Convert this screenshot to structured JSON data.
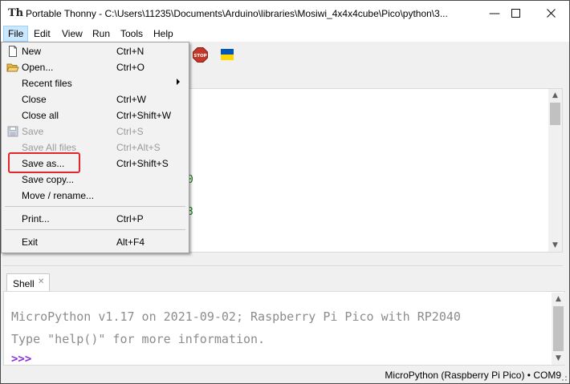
{
  "window": {
    "title": "Portable Thonny  -  C:\\Users\\11235\\Documents\\Arduino\\libraries\\Mosiwi_4x4x4cube\\Pico\\python\\3...",
    "app_icon_glyph": "Th",
    "controls": {
      "minimize": "—",
      "maximize": "☐",
      "close": "✕"
    }
  },
  "menubar": {
    "items": [
      {
        "label": "File"
      },
      {
        "label": "Edit"
      },
      {
        "label": "View"
      },
      {
        "label": "Run"
      },
      {
        "label": "Tools"
      },
      {
        "label": "Help"
      }
    ]
  },
  "toolbar": {
    "icons": [
      "stop-icon",
      "ukraine-flag-icon"
    ],
    "stop_text": "STOP"
  },
  "file_menu": {
    "items": [
      {
        "label": "New",
        "accel": "Ctrl+N",
        "icon": "new-file-icon",
        "enabled": true
      },
      {
        "label": "Open...",
        "accel": "Ctrl+O",
        "icon": "open-folder-icon",
        "enabled": true
      },
      {
        "label": "Recent files",
        "accel": "",
        "submenu": true,
        "enabled": true
      },
      {
        "label": "Close",
        "accel": "Ctrl+W",
        "enabled": true
      },
      {
        "label": "Close all",
        "accel": "Ctrl+Shift+W",
        "enabled": true
      },
      {
        "label": "Save",
        "accel": "Ctrl+S",
        "icon": "save-icon",
        "enabled": false
      },
      {
        "label": "Save All files",
        "accel": "Ctrl+Alt+S",
        "enabled": false
      },
      {
        "label": "Save as...",
        "accel": "Ctrl+Shift+S",
        "enabled": true,
        "highlighted": true
      },
      {
        "label": "Save copy...",
        "accel": "",
        "enabled": true
      },
      {
        "label": "Move / rename...",
        "accel": "",
        "enabled": true
      },
      {
        "label": "Print...",
        "accel": "Ctrl+P",
        "enabled": true
      },
      {
        "label": "Exit",
        "accel": "Alt+F4",
        "enabled": true
      }
    ],
    "highlight_color": "#e3262b"
  },
  "editor": {
    "visible_fragments": [
      "0",
      "3"
    ]
  },
  "shell": {
    "tab_label": "Shell",
    "tab_close": "✕",
    "lines": [
      "MicroPython v1.17 on 2021-09-02; Raspberry Pi Pico with RP2040",
      "Type \"help()\" for more information."
    ],
    "prompt": ">>>"
  },
  "statusbar": {
    "text": "MicroPython (Raspberry Pi Pico)  •  COM9"
  },
  "colors": {
    "menu_active_bg": "#cce8ff",
    "prompt": "#8a2be2",
    "shell_text": "#8c8c8c",
    "stop_red": "#c0392b",
    "flag_blue": "#0057b7",
    "flag_yellow": "#ffd700"
  }
}
